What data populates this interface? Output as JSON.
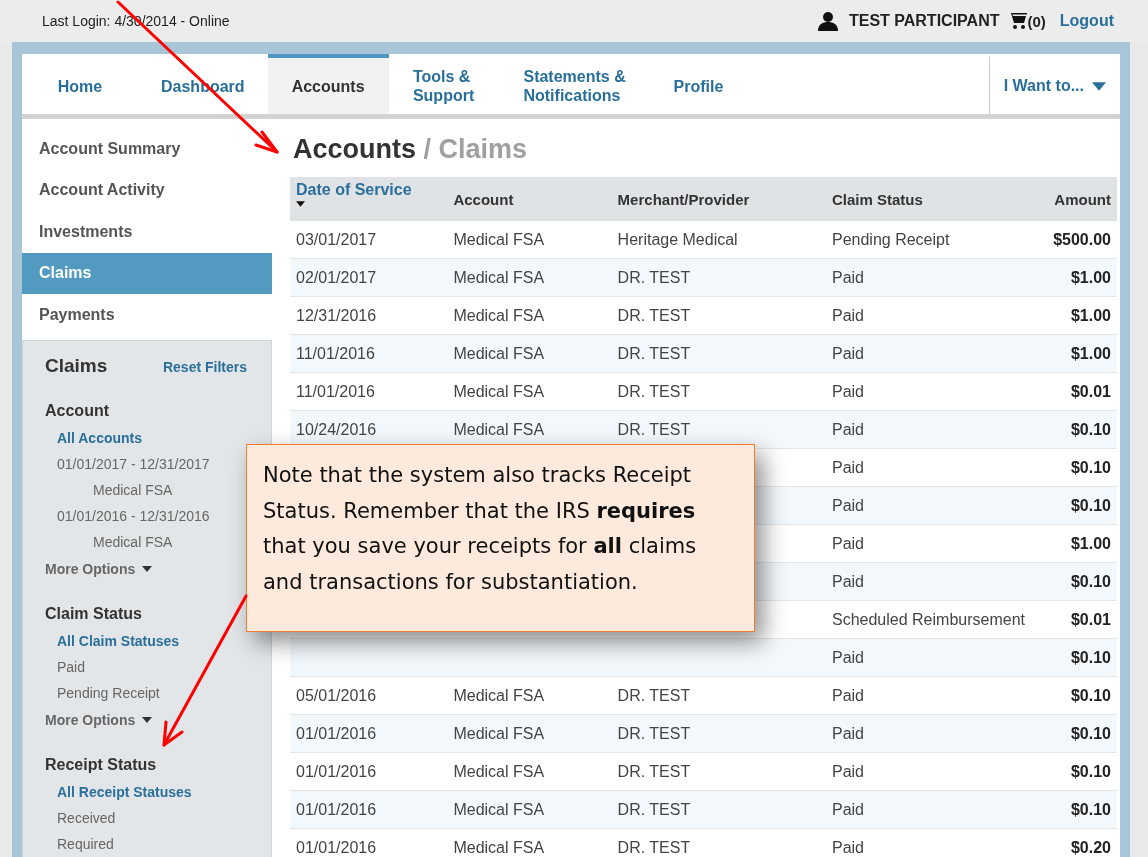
{
  "top_bar": {
    "last_login": "Last Login: 4/30/2014 - Online",
    "user_name": "TEST PARTICIPANT",
    "cart_count": "(0)",
    "logout": "Logout"
  },
  "nav_tabs": [
    {
      "label": "Home",
      "selected": false
    },
    {
      "label": "Dashboard",
      "selected": false
    },
    {
      "label": "Accounts",
      "selected": true
    },
    {
      "label": "Tools &\nSupport",
      "selected": false
    },
    {
      "label": "Statements &\nNotifications",
      "selected": false
    },
    {
      "label": "Profile",
      "selected": false
    }
  ],
  "i_want_to": "I Want to...",
  "sidebar": {
    "items": [
      {
        "label": "Account Summary",
        "selected": false
      },
      {
        "label": "Account Activity",
        "selected": false
      },
      {
        "label": "Investments",
        "selected": false
      },
      {
        "label": "Claims",
        "selected": true
      },
      {
        "label": "Payments",
        "selected": false
      }
    ],
    "filters": {
      "title": "Claims",
      "reset": "Reset Filters",
      "sections": [
        {
          "title": "Account",
          "options": [
            {
              "label": "All Accounts",
              "selected": true
            },
            {
              "label": "01/01/2017 - 12/31/2017",
              "selected": false,
              "children": [
                {
                  "label": "Medical FSA",
                  "selected": false
                }
              ]
            },
            {
              "label": "01/01/2016 - 12/31/2016",
              "selected": false,
              "children": [
                {
                  "label": "Medical FSA",
                  "selected": false
                }
              ]
            }
          ],
          "more": "More Options"
        },
        {
          "title": "Claim Status",
          "options": [
            {
              "label": "All Claim Statuses",
              "selected": true
            },
            {
              "label": "Paid",
              "selected": false
            },
            {
              "label": "Pending Receipt",
              "selected": false
            }
          ],
          "more": "More Options"
        },
        {
          "title": "Receipt Status",
          "options": [
            {
              "label": "All Receipt Statuses",
              "selected": true
            },
            {
              "label": "Received",
              "selected": false
            },
            {
              "label": "Required",
              "selected": false
            }
          ]
        }
      ]
    }
  },
  "page_title": {
    "section": "Accounts",
    "separator": "/",
    "page": "Claims"
  },
  "table": {
    "columns": [
      {
        "label": "Date of Service",
        "sorted": true
      },
      {
        "label": "Account",
        "sorted": false
      },
      {
        "label": "Merchant/Provider",
        "sorted": false
      },
      {
        "label": "Claim Status",
        "sorted": false
      },
      {
        "label": "Amount",
        "sorted": false
      }
    ],
    "rows": [
      {
        "date": "03/01/2017",
        "account": "Medical FSA",
        "merchant": "Heritage Medical",
        "status": "Pending Receipt",
        "amount": "$500.00"
      },
      {
        "date": "02/01/2017",
        "account": "Medical FSA",
        "merchant": "DR. TEST",
        "status": "Paid",
        "amount": "$1.00"
      },
      {
        "date": "12/31/2016",
        "account": "Medical FSA",
        "merchant": "DR. TEST",
        "status": "Paid",
        "amount": "$1.00"
      },
      {
        "date": "11/01/2016",
        "account": "Medical FSA",
        "merchant": "DR. TEST",
        "status": "Paid",
        "amount": "$1.00"
      },
      {
        "date": "11/01/2016",
        "account": "Medical FSA",
        "merchant": "DR. TEST",
        "status": "Paid",
        "amount": "$0.01"
      },
      {
        "date": "10/24/2016",
        "account": "Medical FSA",
        "merchant": "DR. TEST",
        "status": "Paid",
        "amount": "$0.10"
      },
      {
        "status": "Paid",
        "amount": "$0.10"
      },
      {
        "status": "Paid",
        "amount": "$0.10"
      },
      {
        "status": "Paid",
        "amount": "$1.00"
      },
      {
        "status": "Paid",
        "amount": "$0.10"
      },
      {
        "status": "Scheduled Reimbursement",
        "amount": "$0.01"
      },
      {
        "status": "Paid",
        "amount": "$0.10"
      },
      {
        "date": "05/01/2016",
        "account": "Medical FSA",
        "merchant": "DR. TEST",
        "status": "Paid",
        "amount": "$0.10"
      },
      {
        "date": "01/01/2016",
        "account": "Medical FSA",
        "merchant": "DR. TEST",
        "status": "Paid",
        "amount": "$0.10"
      },
      {
        "date": "01/01/2016",
        "account": "Medical FSA",
        "merchant": "DR. TEST",
        "status": "Paid",
        "amount": "$0.10"
      },
      {
        "date": "01/01/2016",
        "account": "Medical FSA",
        "merchant": "DR. TEST",
        "status": "Paid",
        "amount": "$0.10"
      },
      {
        "date": "01/01/2016",
        "account": "Medical FSA",
        "merchant": "DR. TEST",
        "status": "Paid",
        "amount": "$0.20"
      }
    ]
  },
  "callout": {
    "text": "Note that the system also tracks Receipt Status. Remember that the IRS **requires** that you save your receipts for **all** claims and transactions for substantiation."
  }
}
